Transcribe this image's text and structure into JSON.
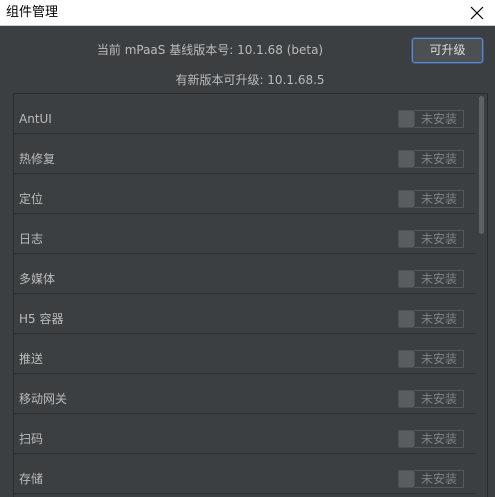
{
  "window": {
    "title": "组件管理"
  },
  "header": {
    "baseline_text": "当前 mPaaS 基线版本号: 10.1.68 (beta)",
    "new_version_text": "有新版本可升级: 10.1.68.5",
    "upgrade_button_label": "可升级"
  },
  "components": [
    {
      "name": "AntUI",
      "status": "未安装"
    },
    {
      "name": "热修复",
      "status": "未安装"
    },
    {
      "name": "定位",
      "status": "未安装"
    },
    {
      "name": "日志",
      "status": "未安装"
    },
    {
      "name": "多媒体",
      "status": "未安装"
    },
    {
      "name": "H5 容器",
      "status": "未安装"
    },
    {
      "name": "推送",
      "status": "未安装"
    },
    {
      "name": "移动网关",
      "status": "未安装"
    },
    {
      "name": "扫码",
      "status": "未安装"
    },
    {
      "name": "存储",
      "status": "未安装"
    }
  ],
  "icons": {
    "close": "close-icon"
  }
}
